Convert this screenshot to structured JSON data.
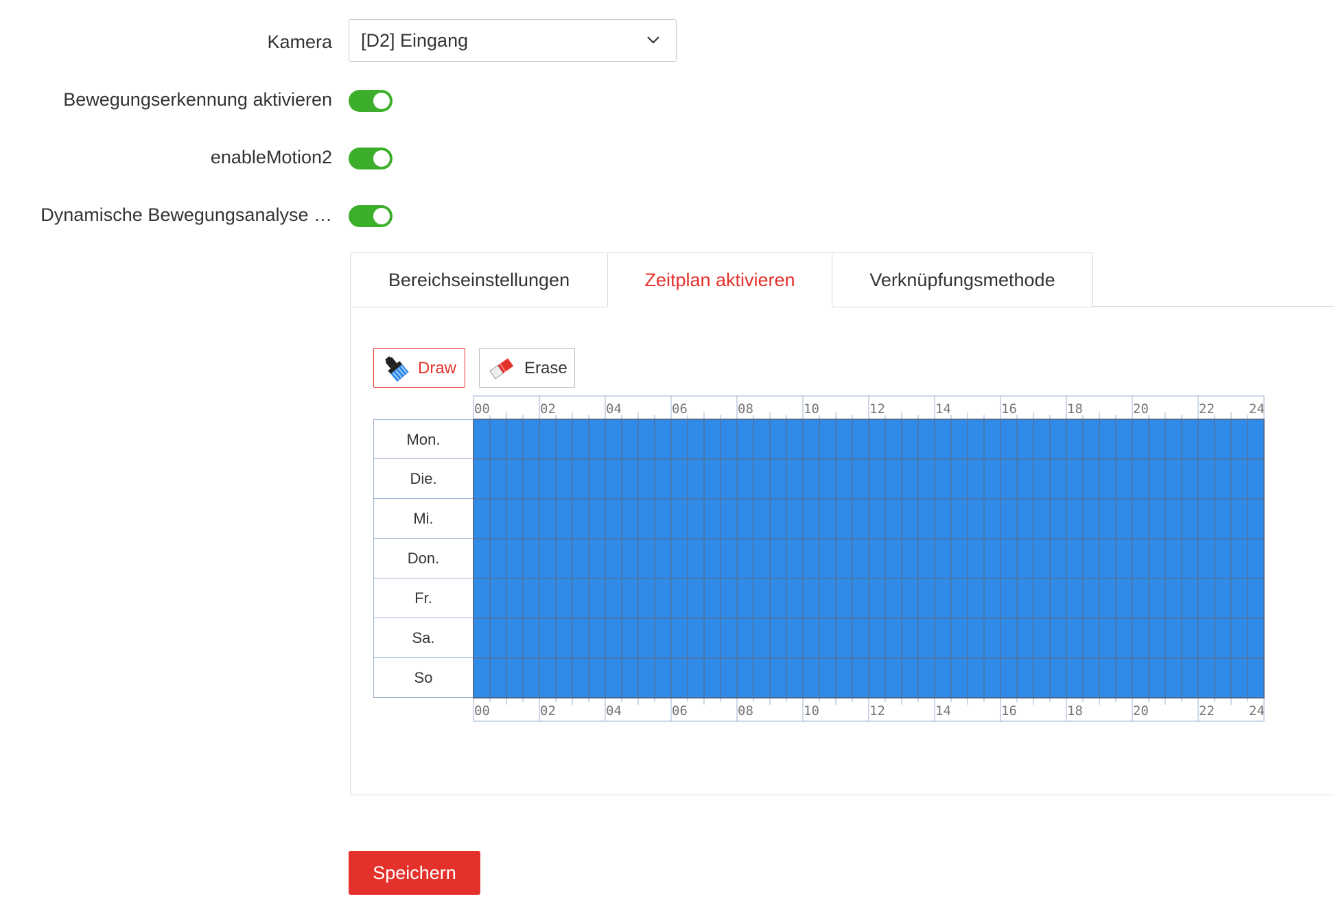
{
  "form": {
    "camera_label": "Kamera",
    "camera_value": "[D2] Eingang",
    "motion_label": "Bewegungserkennung aktivieren",
    "motion_on": true,
    "motion2_label": "enableMotion2",
    "motion2_on": true,
    "dynamic_label": "Dynamische Bewegungsanalyse …",
    "dynamic_on": true
  },
  "tabs": [
    {
      "label": "Bereichseinstellungen",
      "active": false
    },
    {
      "label": "Zeitplan aktivieren",
      "active": true
    },
    {
      "label": "Verknüpfungsmethode",
      "active": false
    }
  ],
  "toolbar": {
    "draw_label": "Draw",
    "erase_label": "Erase",
    "active_tool": "draw"
  },
  "schedule": {
    "days": [
      "Mon.",
      "Die.",
      "Mi.",
      "Don.",
      "Fr.",
      "Sa.",
      "So"
    ],
    "hour_ticks": [
      "00",
      "02",
      "04",
      "06",
      "08",
      "10",
      "12",
      "14",
      "16",
      "18",
      "20",
      "22",
      "24"
    ],
    "filled_color": "#2f8ae8",
    "filled_hours": [
      [
        0,
        24
      ],
      [
        0,
        24
      ],
      [
        0,
        24
      ],
      [
        0,
        24
      ],
      [
        0,
        24
      ],
      [
        0,
        24
      ],
      [
        0,
        24
      ]
    ]
  },
  "actions": {
    "save_label": "Speichern"
  },
  "colors": {
    "accent": "#e4312b",
    "toggle_on": "#3dae2b",
    "schedule_fill": "#2f8ae8",
    "grid_border": "#9fb2cf"
  },
  "icons": {
    "dropdown": "chevron-down-icon",
    "draw": "brush-icon",
    "erase": "eraser-icon"
  }
}
